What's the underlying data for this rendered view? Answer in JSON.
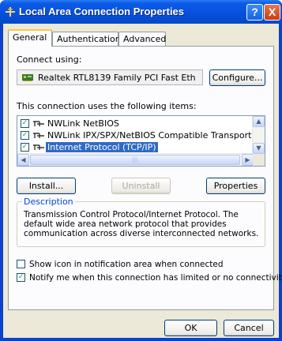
{
  "window": {
    "title": "Local Area Connection Properties",
    "help_label": "?",
    "close_label": "X"
  },
  "tabs": [
    {
      "label": "General",
      "active": true
    },
    {
      "label": "Authentication",
      "active": false
    },
    {
      "label": "Advanced",
      "active": false
    }
  ],
  "general": {
    "connect_using_label": "Connect using:",
    "adapter_name": "Realtek RTL8139 Family PCI Fast Eth",
    "configure_label": "Configure...",
    "items_label": "This connection uses the following items:",
    "items": [
      {
        "label": "NWLink NetBIOS",
        "checked": true,
        "selected": false
      },
      {
        "label": "NWLink IPX/SPX/NetBIOS Compatible Transport Prot",
        "checked": true,
        "selected": false
      },
      {
        "label": "Internet Protocol (TCP/IP)",
        "checked": true,
        "selected": true
      }
    ],
    "install_label": "Install...",
    "uninstall_label": "Uninstall",
    "properties_label": "Properties",
    "description_title": "Description",
    "description_text": "Transmission Control Protocol/Internet Protocol. The default wide area network protocol that provides communication across diverse interconnected networks.",
    "show_icon_label": "Show icon in notification area when connected",
    "show_icon_checked": false,
    "notify_label": "Notify me when this connection has limited or no connectivity",
    "notify_checked": true
  },
  "footer": {
    "ok_label": "OK",
    "cancel_label": "Cancel"
  },
  "colors": {
    "titlebar": "#0750dc",
    "selection": "#316ac5",
    "dialog_bg": "#ece9d8"
  }
}
